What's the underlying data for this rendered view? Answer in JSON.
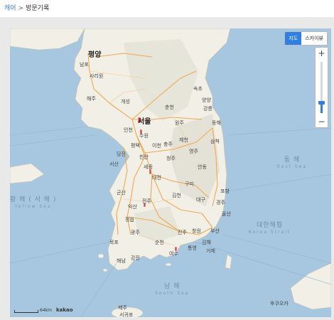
{
  "breadcrumb": {
    "parent": "캐어",
    "separator": ">",
    "current": "방문기록"
  },
  "map": {
    "type_control": {
      "active": "지도",
      "inactive": "스카이뷰"
    },
    "zoom": {
      "plus": "+",
      "minus": "−",
      "level_fraction": 0.2
    },
    "scale": {
      "label": "64km",
      "logo": "kakao"
    },
    "seas": [
      {
        "ko": "황 해 ( 서 해 )",
        "en": "Yellow Sea"
      },
      {
        "ko": "동 해",
        "en": "East Sea"
      },
      {
        "ko": "대한해협",
        "en": "Korea Strait"
      },
      {
        "ko": "남 해",
        "en": "South Sea"
      }
    ],
    "cities": [
      "평양",
      "남포",
      "사리원",
      "해주",
      "개성",
      "서울",
      "인천",
      "수원",
      "천안",
      "세종",
      "대전",
      "청주",
      "전주",
      "광주",
      "목포",
      "여수",
      "진주",
      "대구",
      "포항",
      "울산",
      "부산",
      "창원",
      "김해",
      "안동",
      "영주",
      "원주",
      "춘천",
      "강릉",
      "동해",
      "삼척",
      "속초",
      "제천",
      "충주",
      "구미",
      "김천",
      "군산",
      "순천",
      "경주",
      "양양",
      "통영",
      "거제",
      "제주",
      "서귀포",
      "후쿠오카",
      "이천",
      "평택",
      "당진",
      "서산",
      "익산",
      "정읍",
      "강진",
      "해남"
    ],
    "colors": {
      "sea": "#a6c7df",
      "land": "#f1efe6",
      "road": "#f2a94e",
      "accent": "#2f7ee3"
    },
    "markers": [
      {
        "name": "서울"
      },
      {
        "name": "수원"
      },
      {
        "name": "대전"
      },
      {
        "name": "전주"
      },
      {
        "name": "여수"
      }
    ]
  }
}
